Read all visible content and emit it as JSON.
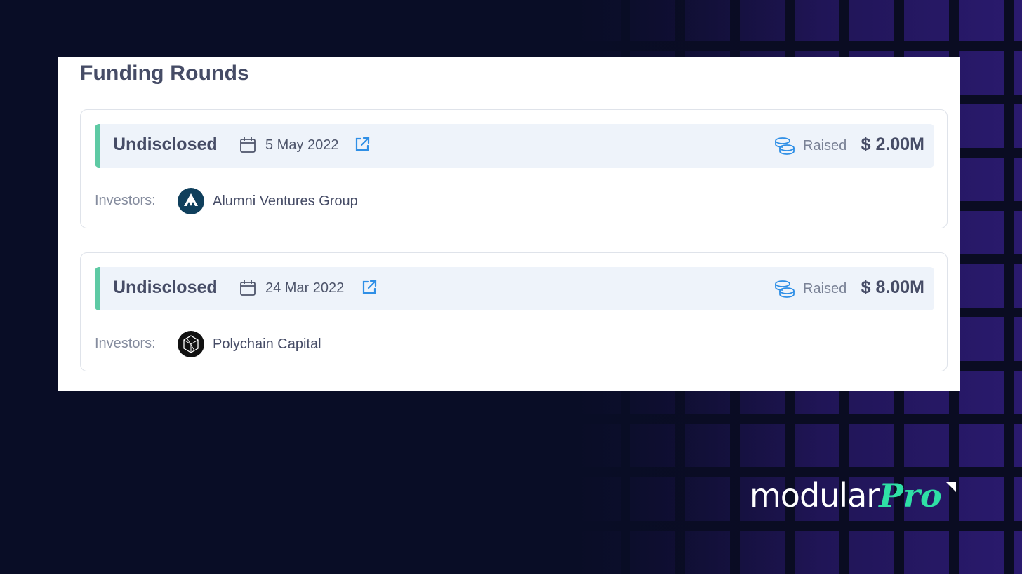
{
  "section": {
    "title": "Funding Rounds"
  },
  "rounds": [
    {
      "name": "Undisclosed",
      "date": "5 May 2022",
      "raised_label": "Raised",
      "raised_amount": "$ 2.00M",
      "investors_label": "Investors:",
      "investor": {
        "name": "Alumni Ventures Group",
        "logo": "alumni-ventures-logo"
      }
    },
    {
      "name": "Undisclosed",
      "date": "24 Mar 2022",
      "raised_label": "Raised",
      "raised_amount": "$ 8.00M",
      "investors_label": "Investors:",
      "investor": {
        "name": "Polychain Capital",
        "logo": "polychain-capital-logo"
      }
    }
  ],
  "brand": {
    "main": "modular",
    "accent": "Pro"
  },
  "colors": {
    "background": "#090d26",
    "accent_bar": "#5ecaa4",
    "link_blue": "#2f8fe6",
    "brand_green": "#2fe0a6",
    "text_dark": "#464c66"
  },
  "icons": [
    "calendar-icon",
    "external-link-icon",
    "coins-icon"
  ]
}
